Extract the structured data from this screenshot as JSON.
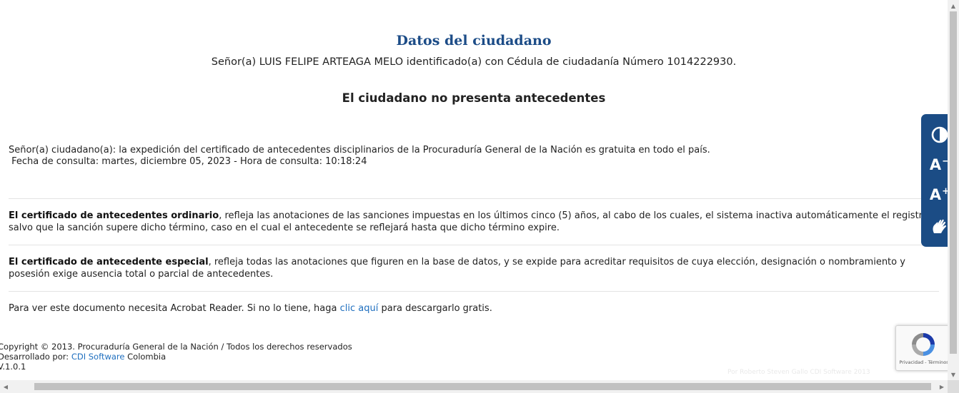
{
  "header": {
    "title": "Datos del ciudadano",
    "citizen_line": "Señor(a)  LUIS FELIPE ARTEAGA MELO identificado(a) con Cédula de ciudadanía Número 1014222930.",
    "status": "El ciudadano no presenta antecedentes"
  },
  "notice": {
    "line1": "Señor(a) ciudadano(a): la expedición del certificado de antecedentes disciplinarios de la Procuraduría General de la Nación es gratuita en todo el país.",
    "line2": " Fecha de consulta: martes, diciembre 05, 2023 - Hora de consulta: 10:18:24"
  },
  "paragraphs": {
    "ordinary_bold": "El certificado de antecedentes ordinario",
    "ordinary_text": ", refleja las anotaciones de las sanciones impuestas en los últimos cinco (5) años, al cabo de los cuales, el sistema inactiva automáticamente el registro salvo que la sanción supere dicho término, caso en el cual el antecedente se reflejará hasta que dicho término expire.",
    "special_bold": "El certificado de antecedente especial",
    "special_text": ", refleja todas las anotaciones que figuren en la base de datos, y se expide para acreditar requisitos de cuya elección, designación o nombramiento y posesión exige ausencia total o parcial de antecedentes.",
    "reader_before": "Para ver este documento necesita Acrobat Reader. Si no lo tiene, haga ",
    "reader_link": "clic aquí",
    "reader_after": " para descargarlo gratis."
  },
  "footer": {
    "copyright": "Copyright © 2013. Procuraduría General de la Nación / Todos los derechos reservados",
    "dev_prefix": "Desarrollado por: ",
    "dev_link": "CDI Software",
    "dev_suffix": " Colombia",
    "version": "V.1.0.1",
    "faint_text": "Por Roberto Steven Gallo CDI Software 2013"
  },
  "accessibility": {
    "contrast_icon": "contrast-icon",
    "decrease_label": "A",
    "decrease_sign": "−",
    "increase_label": "A",
    "increase_sign": "+",
    "sign_language_icon": "hand-icon"
  },
  "recaptcha": {
    "terms": "Privacidad - Términos"
  },
  "colors": {
    "title": "#1c4c87",
    "link": "#1f6fbf",
    "toolbar": "#1b4c85"
  }
}
